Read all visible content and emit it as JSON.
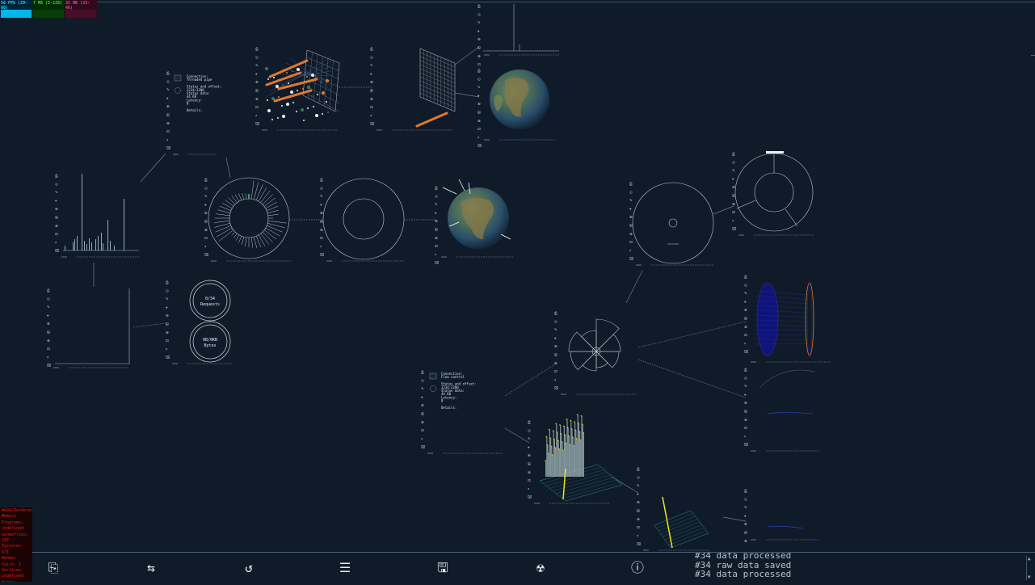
{
  "stats": {
    "fps": "56 FPS (29-60)",
    "ms": "7 MS (5-126)",
    "mb": "35 MB (33-46)"
  },
  "render_info": [
    "WebGLRenderer",
    "Memory",
    "Programs:",
    "undefined",
    "Geometries: 187",
    "Textures: 671",
    "Render",
    "Calls: 1",
    "Vertices:",
    "undefined",
    "Faces: undefined",
    "Points: 4"
  ],
  "summaries": {
    "requests": {
      "value": "0/34",
      "label": "Requests"
    },
    "bytes": {
      "value": "0B/0KB",
      "label": "Bytes"
    }
  },
  "detail_panels": {
    "a": [
      "Connection:",
      "Threaded pipe",
      "",
      "Status and offset:",
      "1234:3200",
      "Status data:",
      "44 KB",
      "Latency:",
      "0",
      "",
      "Details:"
    ],
    "b": [
      "Connection:",
      "Flow control",
      "",
      "Status and offset:",
      "1234:3200",
      "Status data:",
      "44 KB",
      "Latency:",
      "0",
      "",
      "Details:"
    ]
  },
  "toolbar": {
    "buttons": [
      {
        "name": "save-layout-icon",
        "glyph": "⎘"
      },
      {
        "name": "sync-icon",
        "glyph": "⇆"
      },
      {
        "name": "reset-icon",
        "glyph": "↺"
      },
      {
        "name": "align-icon",
        "glyph": "☰"
      },
      {
        "name": "floppy-icon",
        "glyph": "🖫"
      },
      {
        "name": "radiation-icon",
        "glyph": "☢"
      },
      {
        "name": "info-icon",
        "glyph": "ⓘ"
      }
    ]
  },
  "log": [
    "#34 data processed",
    "#34 raw data saved",
    "#34 data processed"
  ],
  "colors": {
    "background": "#101b2a",
    "line": "#6f8fa6",
    "orange": "#e2772f",
    "yellow": "#f2e21b",
    "navy": "#10147a",
    "earth_ocean": "#2c5a7a",
    "earth_land": "#8a7a45"
  }
}
